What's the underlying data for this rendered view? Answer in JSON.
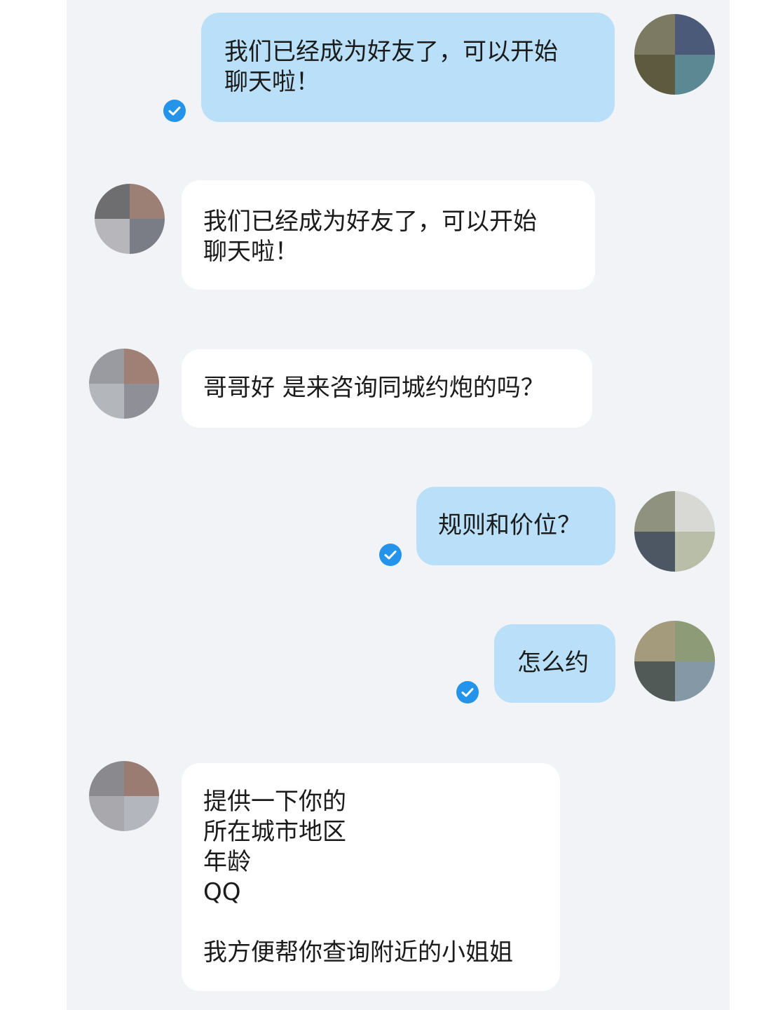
{
  "messages": [
    {
      "direction": "sent",
      "text": "我们已经成为好友了，可以开始\n聊天啦！",
      "read": true
    },
    {
      "direction": "received",
      "text": "我们已经成为好友了，可以开始\n聊天啦！"
    },
    {
      "direction": "received",
      "text": "哥哥好 是来咨询同城约炮的吗？"
    },
    {
      "direction": "sent",
      "text": "规则和价位？",
      "read": true
    },
    {
      "direction": "sent",
      "text": "怎么约",
      "read": true
    },
    {
      "direction": "received",
      "text": "提供一下你的\n所在城市地区\n年龄\nQQ\n\n我方便帮你查询附近的小姐姐"
    }
  ],
  "icons": {
    "read_receipt": "check-circle-icon",
    "avatar": "pixelated-avatar"
  },
  "colors": {
    "chat_background": "#f1f3f7",
    "sent_bubble": "#b9e0f8",
    "received_bubble": "#ffffff",
    "read_check": "#2394ea",
    "text": "#1b1b1b"
  }
}
